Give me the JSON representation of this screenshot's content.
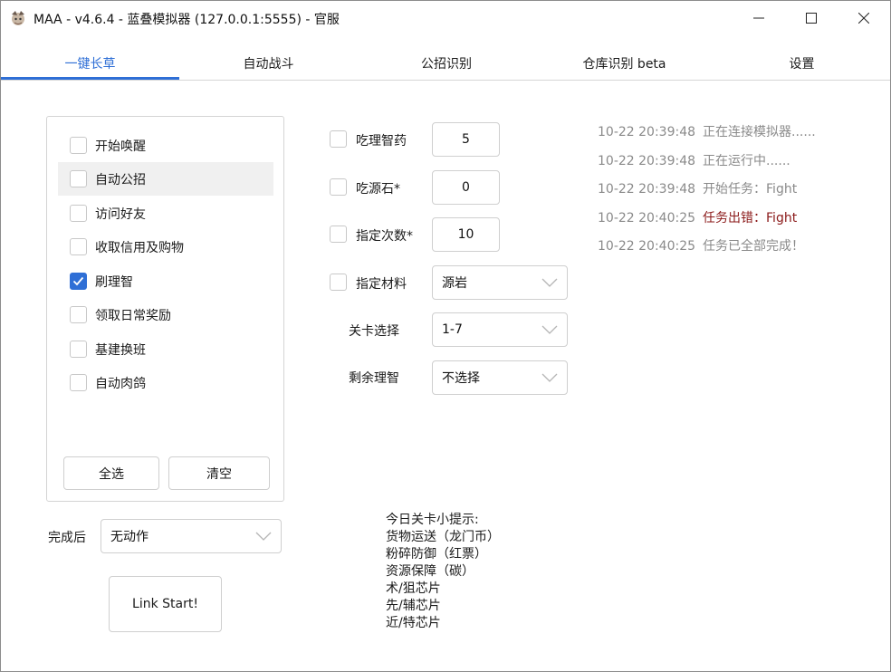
{
  "window": {
    "title": "MAA - v4.6.4 - 蓝叠模拟器 (127.0.0.1:5555) - 官服"
  },
  "tabs": [
    {
      "label": "一键长草"
    },
    {
      "label": "自动战斗"
    },
    {
      "label": "公招识别"
    },
    {
      "label": "仓库识别 beta"
    },
    {
      "label": "设置"
    }
  ],
  "tasks": [
    {
      "label": "开始唤醒",
      "checked": false
    },
    {
      "label": "自动公招",
      "checked": false
    },
    {
      "label": "访问好友",
      "checked": false
    },
    {
      "label": "收取信用及购物",
      "checked": false
    },
    {
      "label": "刷理智",
      "checked": true
    },
    {
      "label": "领取日常奖励",
      "checked": false
    },
    {
      "label": "基建换班",
      "checked": false
    },
    {
      "label": "自动肉鸽",
      "checked": false
    }
  ],
  "task_buttons": {
    "select_all": "全选",
    "clear": "清空"
  },
  "after_complete": {
    "label": "完成后",
    "value": "无动作"
  },
  "start_button": "Link Start!",
  "options": {
    "medicine": {
      "label": "吃理智药",
      "value": "5",
      "checked": false
    },
    "stone": {
      "label": "吃源石*",
      "value": "0",
      "checked": false
    },
    "times": {
      "label": "指定次数*",
      "value": "10",
      "checked": false
    },
    "material": {
      "label": "指定材料",
      "value": "源岩",
      "checked": false
    },
    "stage": {
      "label": "关卡选择",
      "value": "1-7"
    },
    "remaining": {
      "label": "剩余理智",
      "value": "不选择"
    }
  },
  "tips": {
    "title": "今日关卡小提示:",
    "lines": [
      "货物运送（龙门币）",
      "粉碎防御（红票）",
      "资源保障（碳）",
      "术/狙芯片",
      "先/辅芯片",
      "近/特芯片"
    ]
  },
  "log": [
    {
      "time": "10-22  20:39:48",
      "msg": "正在连接模拟器......"
    },
    {
      "time": "10-22  20:39:48",
      "msg": "正在运行中......"
    },
    {
      "time": "10-22  20:39:48",
      "msg": "开始任务：Fight"
    },
    {
      "time": "10-22  20:40:25",
      "msg": "任务出错：Fight",
      "error": true
    },
    {
      "time": "10-22  20:40:25",
      "msg": "任务已全部完成！"
    }
  ],
  "colors": {
    "accent": "#2f6fd6",
    "error": "#8b1a1a",
    "log_text": "#8a8a8a"
  }
}
